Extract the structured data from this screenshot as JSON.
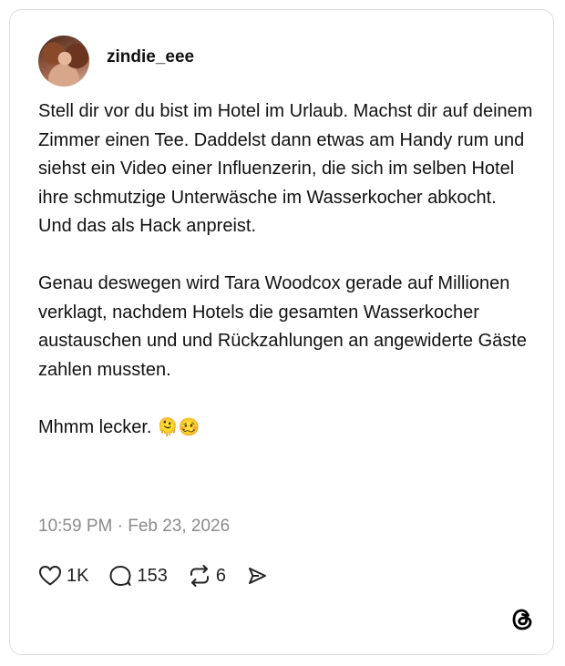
{
  "post": {
    "username": "zindie_eee",
    "paragraphs": [
      "Stell dir vor du bist im Hotel im Urlaub. Machst dir auf deinem Zimmer einen Tee. Daddelst dann etwas am Handy rum und siehst ein Video einer Influenzerin, die sich im selben Hotel ihre schmutzige Unterwäsche im Wasserkocher abkocht. Und das als Hack anpreist.",
      "Genau deswegen wird Tara Woodcox gerade auf Millionen verklagt, nachdem Hotels die gesamten Wasserkocher austauschen und und Rückzahlungen an angewiderte Gäste zahlen mussten."
    ],
    "closing_text": "Mhmm lecker.",
    "closing_emojis": "🫠🥴",
    "timestamp": "10:59 PM · Feb 23, 2026"
  },
  "actions": {
    "likes": "1K",
    "replies": "153",
    "reposts": "6"
  },
  "icons": {
    "like": "heart-icon",
    "reply": "speech-bubble-icon",
    "repost": "repost-icon",
    "share": "send-icon",
    "brand": "threads-logo-icon"
  }
}
